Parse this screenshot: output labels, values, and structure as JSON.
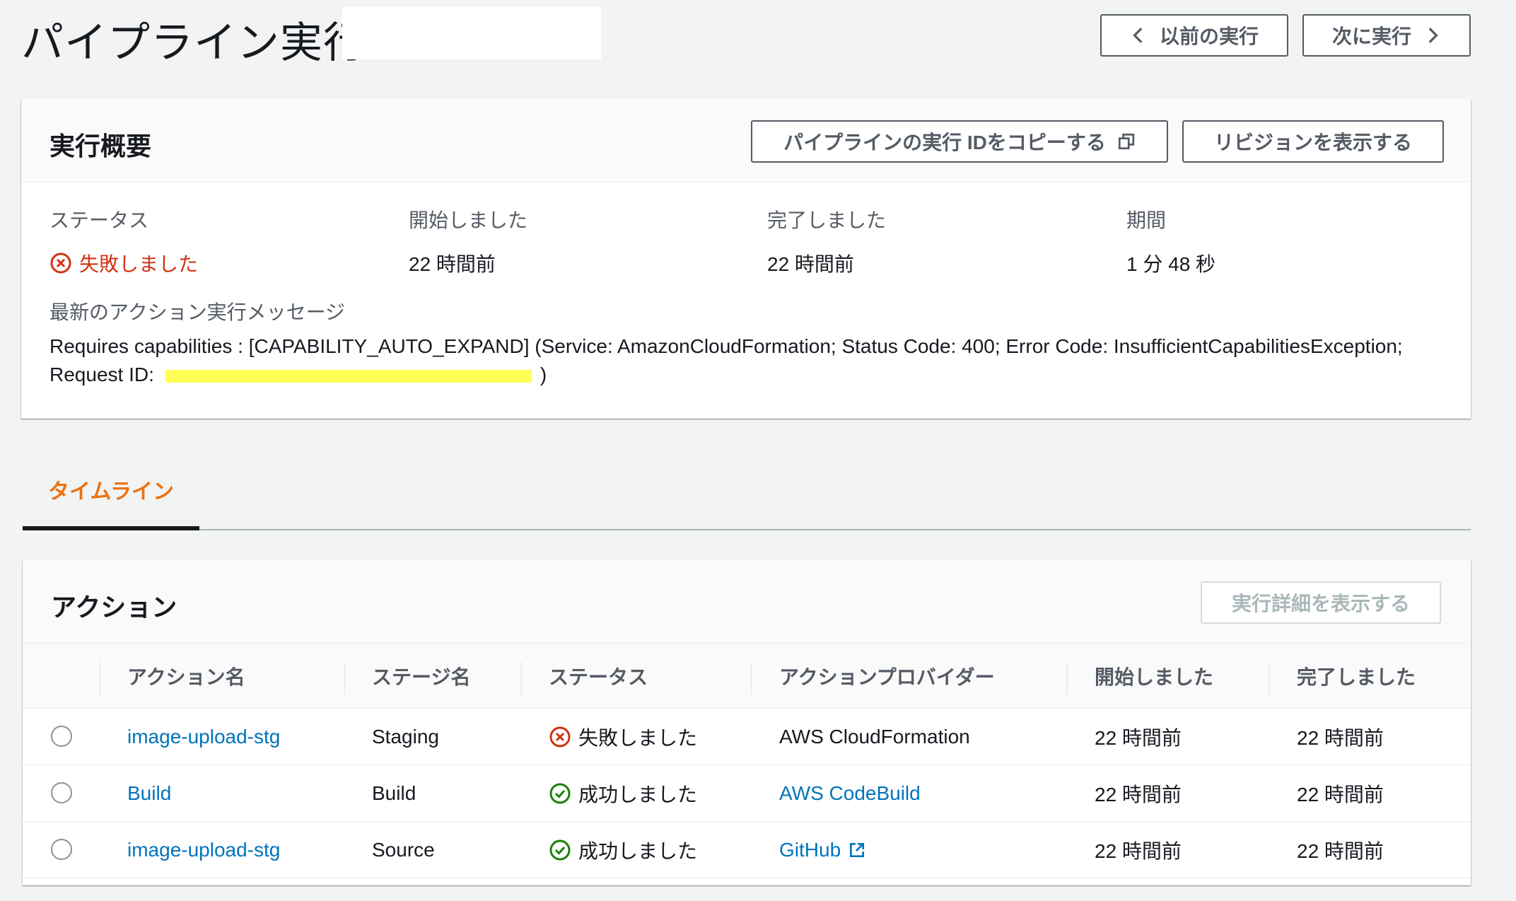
{
  "header": {
    "title": "パイプライン実行",
    "prev_label": "以前の実行",
    "next_label": "次に実行"
  },
  "summary": {
    "title": "実行概要",
    "copy_button": "パイプラインの実行 IDをコピーする",
    "revision_button": "リビジョンを表示する",
    "status_label": "ステータス",
    "status_value": "失敗しました",
    "started_label": "開始しました",
    "started_value": "22 時間前",
    "completed_label": "完了しました",
    "completed_value": "22 時間前",
    "duration_label": "期間",
    "duration_value": "1 分 48 秒",
    "message_label": "最新のアクション実行メッセージ",
    "message_line1": "Requires capabilities : [CAPABILITY_AUTO_EXPAND] (Service: AmazonCloudFormation; Status Code: 400; Error Code: InsufficientCapabilitiesException;",
    "message_line2_prefix": "Request ID:",
    "message_line2_suffix": ")"
  },
  "tabs": [
    {
      "label": "タイムライン",
      "active": true
    }
  ],
  "actions": {
    "title": "アクション",
    "details_button": "実行詳細を表示する",
    "columns": [
      "アクション名",
      "ステージ名",
      "ステータス",
      "アクションプロバイダー",
      "開始しました",
      "完了しました"
    ],
    "rows": [
      {
        "name": "image-upload-stg",
        "stage": "Staging",
        "status": "失敗しました",
        "status_type": "failed",
        "provider": "AWS CloudFormation",
        "provider_link": false,
        "provider_external": false,
        "started": "22 時間前",
        "completed": "22 時間前"
      },
      {
        "name": "Build",
        "stage": "Build",
        "status": "成功しました",
        "status_type": "success",
        "provider": "AWS CodeBuild",
        "provider_link": true,
        "provider_external": false,
        "started": "22 時間前",
        "completed": "22 時間前"
      },
      {
        "name": "image-upload-stg",
        "stage": "Source",
        "status": "成功しました",
        "status_type": "success",
        "provider": "GitHub",
        "provider_link": true,
        "provider_external": true,
        "started": "22 時間前",
        "completed": "22 時間前"
      }
    ]
  },
  "colors": {
    "failed": "#d13212",
    "success": "#1d8102",
    "link": "#0073bb",
    "tab_active": "#ec7211",
    "redaction_highlight": "#ffff55"
  }
}
